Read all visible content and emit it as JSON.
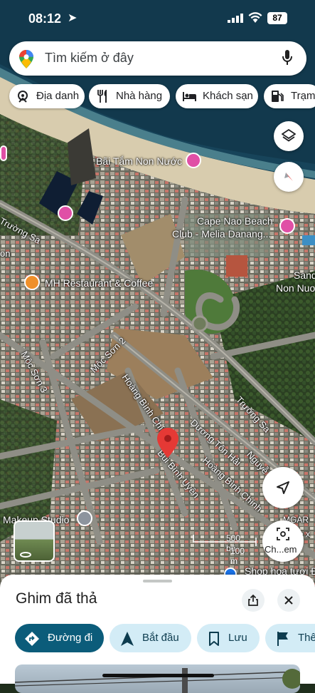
{
  "status_bar": {
    "time": "08:12",
    "battery": "87"
  },
  "search": {
    "placeholder": "Tìm kiếm ở đây"
  },
  "chips": [
    {
      "label": "Địa danh",
      "icon": "landmark-icon"
    },
    {
      "label": "Nhà hàng",
      "icon": "restaurant-icon"
    },
    {
      "label": "Khách sạn",
      "icon": "hotel-icon"
    },
    {
      "label": "Trạm",
      "icon": "gas-station-icon"
    }
  ],
  "map_labels": {
    "beach": "Bãi Tắm Non Nước",
    "cape_nao_1": "Cape Nao Beach",
    "cape_nao_2": "Club - Melia Danang...",
    "mh_restaurant": "MH Restaurant & Coffee",
    "sand_1": "Sand",
    "sand_2": "Non Nuo",
    "makeup": "Makeup Studio",
    "shop": "Shop hoa tươi Đ",
    "mgar": "MGAR",
    "ex": "e x"
  },
  "roads": {
    "truong_sa_left": "Trường Sa",
    "truong_sa_right": "Trường Sa",
    "moc_son_2": "Mộc Sơn 2",
    "moc_son_3": "Mộc Sơn 3",
    "hoang_binh_chinh_1": "Hoàng Bình Chính",
    "hoang_binh_chinh_2": "Hoàng Bình Chính",
    "duong_ton_hai": "Dương Tôn Hải",
    "bui_binh_uyen": "Bùi Bình Uyên",
    "nguyen": "Nguyễ",
    "on": "on"
  },
  "scale": {
    "feet": "500 bộ",
    "meters": "100 m"
  },
  "screenshot_button": {
    "label": "Ch...em"
  },
  "sheet": {
    "title": "Ghim đã thả",
    "actions": [
      {
        "label": "Đường đi",
        "icon": "directions-icon",
        "primary": true
      },
      {
        "label": "Bắt đầu",
        "icon": "navigation-start-icon",
        "primary": false
      },
      {
        "label": "Lưu",
        "icon": "bookmark-icon",
        "primary": false
      },
      {
        "label": "Thê",
        "icon": "flag-icon",
        "primary": false
      }
    ]
  },
  "colors": {
    "primary": "#0b5c7a",
    "secondary_bg": "#d3ecf6",
    "pin": "#e53935",
    "poi_pink": "#e04fa6"
  }
}
